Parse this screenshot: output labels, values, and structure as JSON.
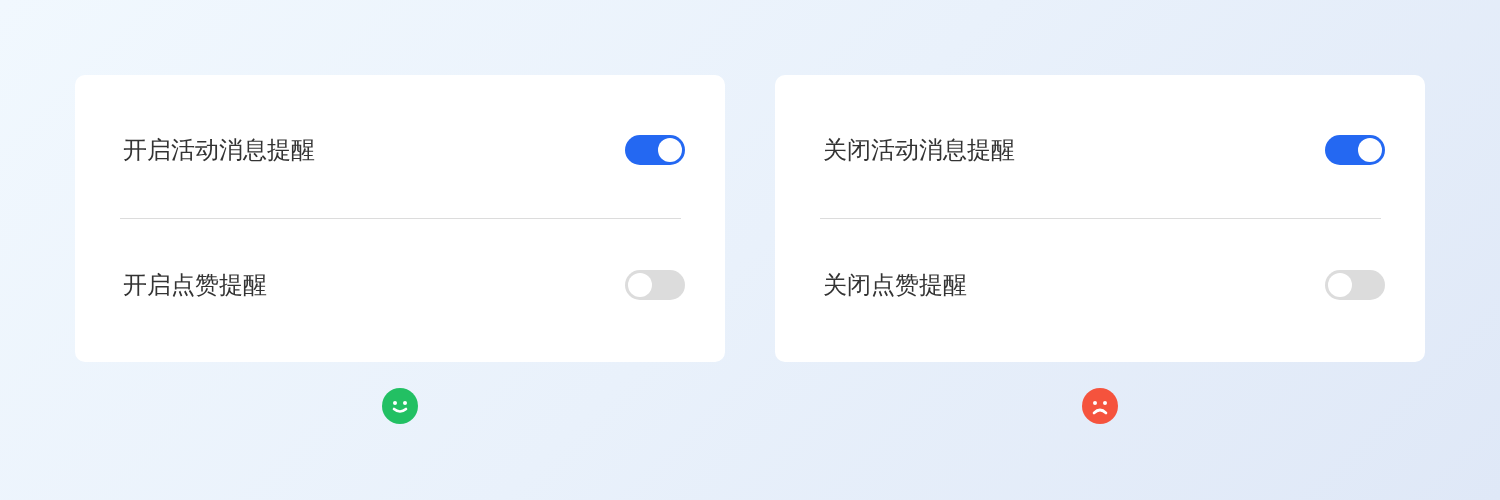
{
  "panels": [
    {
      "settings": [
        {
          "label": "开启活动消息提醒",
          "on": true
        },
        {
          "label": "开启点赞提醒",
          "on": false
        }
      ],
      "verdict": {
        "kind": "good",
        "color": "#22c063"
      }
    },
    {
      "settings": [
        {
          "label": "关闭活动消息提醒",
          "on": true
        },
        {
          "label": "关闭点赞提醒",
          "on": false
        }
      ],
      "verdict": {
        "kind": "bad",
        "color": "#f5533d"
      }
    }
  ]
}
